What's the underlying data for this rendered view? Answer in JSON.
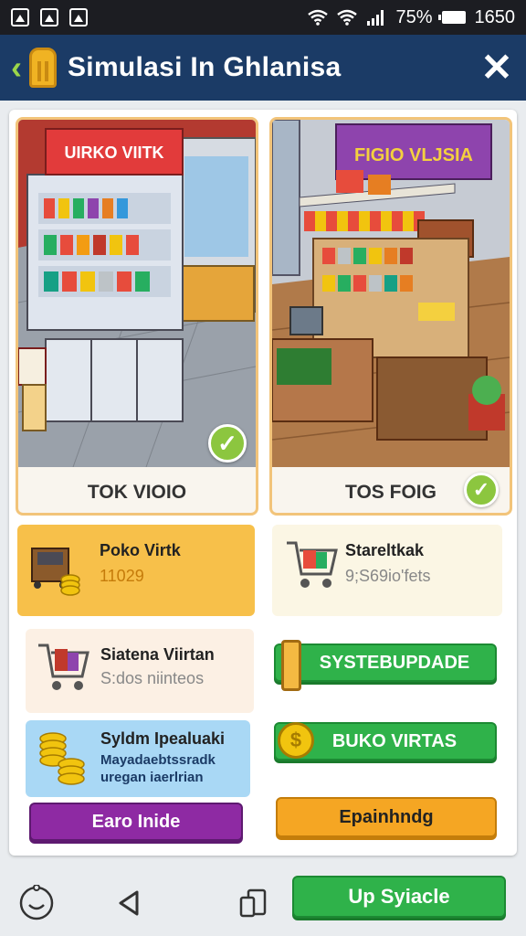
{
  "status": {
    "battery": "75%",
    "time": "1650",
    "notification_icons": [
      "image-icon",
      "image-icon",
      "gallery-icon"
    ]
  },
  "header": {
    "title": "Simulasi In Ghlanisa"
  },
  "stores": [
    {
      "sign": "UIRKO VIITK",
      "label": "TOK VIOIO",
      "selected": true
    },
    {
      "sign": "FIGIO VLJSIA",
      "label": "TOS FOIG",
      "selected": true
    }
  ],
  "tiles": {
    "poko": {
      "title": "Poko Virtk",
      "value": "11029"
    },
    "starel": {
      "title": "Stareltkak",
      "value": "9;S69io'fets"
    },
    "siatena": {
      "title": "Siatena Viirtan",
      "value": "S:dos niinteos"
    },
    "sylom": {
      "title": "Syldm Ipealuaki",
      "subtitle": "Mayadaebtssradk uregan iaerlrian"
    }
  },
  "buttons": {
    "syste_update": "SYSTEBUPDADE",
    "buko_virtas": "BUKO VIRTAS",
    "earo_mide": "Earo Inide",
    "epainhndg": "Epainhndg",
    "up_syiacle": "Up Syiacle"
  },
  "colors": {
    "header": "#1b3b66",
    "green": "#2fb24a",
    "purple": "#8e2aa3",
    "orange": "#f5a623",
    "yellow_tile": "#f7c04a",
    "blue_tile": "#a9d8f5"
  }
}
